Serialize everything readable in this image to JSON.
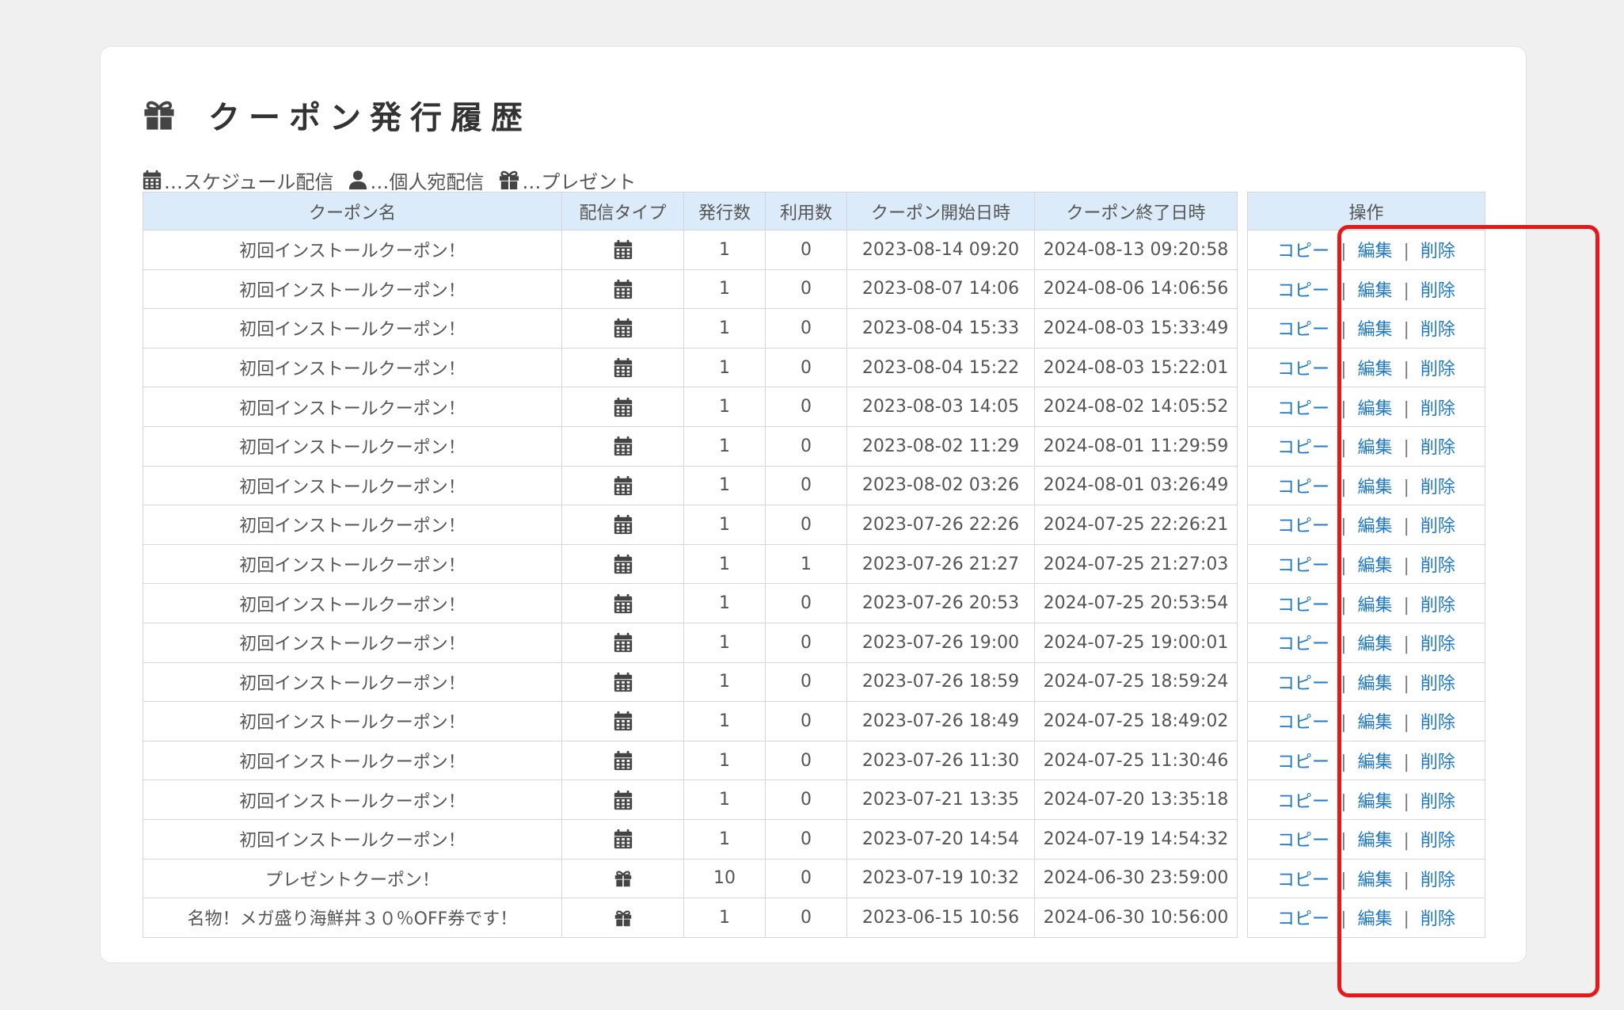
{
  "page": {
    "title": "クーポン発行履歴",
    "title_icon": "gift-icon"
  },
  "legend": [
    {
      "icon": "calendar-icon",
      "label": "…スケジュール配信"
    },
    {
      "icon": "user-icon",
      "label": "…個人宛配信"
    },
    {
      "icon": "gift-icon",
      "label": "…プレゼント"
    }
  ],
  "table": {
    "headers": {
      "name": "クーポン名",
      "type": "配信タイプ",
      "issued": "発行数",
      "used": "利用数",
      "start": "クーポン開始日時",
      "end": "クーポン終了日時",
      "ops": "操作"
    },
    "actions": {
      "copy": "コピー",
      "edit": "編集",
      "delete": "削除",
      "separator": "|"
    },
    "rows": [
      {
        "name": "初回インストールクーポン！",
        "type": "calendar-icon",
        "issued": "1",
        "used": "0",
        "start": "2023-08-14 09:20",
        "end": "2024-08-13 09:20:58"
      },
      {
        "name": "初回インストールクーポン！",
        "type": "calendar-icon",
        "issued": "1",
        "used": "0",
        "start": "2023-08-07 14:06",
        "end": "2024-08-06 14:06:56"
      },
      {
        "name": "初回インストールクーポン！",
        "type": "calendar-icon",
        "issued": "1",
        "used": "0",
        "start": "2023-08-04 15:33",
        "end": "2024-08-03 15:33:49"
      },
      {
        "name": "初回インストールクーポン！",
        "type": "calendar-icon",
        "issued": "1",
        "used": "0",
        "start": "2023-08-04 15:22",
        "end": "2024-08-03 15:22:01"
      },
      {
        "name": "初回インストールクーポン！",
        "type": "calendar-icon",
        "issued": "1",
        "used": "0",
        "start": "2023-08-03 14:05",
        "end": "2024-08-02 14:05:52"
      },
      {
        "name": "初回インストールクーポン！",
        "type": "calendar-icon",
        "issued": "1",
        "used": "0",
        "start": "2023-08-02 11:29",
        "end": "2024-08-01 11:29:59"
      },
      {
        "name": "初回インストールクーポン！",
        "type": "calendar-icon",
        "issued": "1",
        "used": "0",
        "start": "2023-08-02 03:26",
        "end": "2024-08-01 03:26:49"
      },
      {
        "name": "初回インストールクーポン！",
        "type": "calendar-icon",
        "issued": "1",
        "used": "0",
        "start": "2023-07-26 22:26",
        "end": "2024-07-25 22:26:21"
      },
      {
        "name": "初回インストールクーポン！",
        "type": "calendar-icon",
        "issued": "1",
        "used": "1",
        "start": "2023-07-26 21:27",
        "end": "2024-07-25 21:27:03"
      },
      {
        "name": "初回インストールクーポン！",
        "type": "calendar-icon",
        "issued": "1",
        "used": "0",
        "start": "2023-07-26 20:53",
        "end": "2024-07-25 20:53:54"
      },
      {
        "name": "初回インストールクーポン！",
        "type": "calendar-icon",
        "issued": "1",
        "used": "0",
        "start": "2023-07-26 19:00",
        "end": "2024-07-25 19:00:01"
      },
      {
        "name": "初回インストールクーポン！",
        "type": "calendar-icon",
        "issued": "1",
        "used": "0",
        "start": "2023-07-26 18:59",
        "end": "2024-07-25 18:59:24"
      },
      {
        "name": "初回インストールクーポン！",
        "type": "calendar-icon",
        "issued": "1",
        "used": "0",
        "start": "2023-07-26 18:49",
        "end": "2024-07-25 18:49:02"
      },
      {
        "name": "初回インストールクーポン！",
        "type": "calendar-icon",
        "issued": "1",
        "used": "0",
        "start": "2023-07-26 11:30",
        "end": "2024-07-25 11:30:46"
      },
      {
        "name": "初回インストールクーポン！",
        "type": "calendar-icon",
        "issued": "1",
        "used": "0",
        "start": "2023-07-21 13:35",
        "end": "2024-07-20 13:35:18"
      },
      {
        "name": "初回インストールクーポン！",
        "type": "calendar-icon",
        "issued": "1",
        "used": "0",
        "start": "2023-07-20 14:54",
        "end": "2024-07-19 14:54:32"
      },
      {
        "name": "プレゼントクーポン！",
        "type": "gift-icon",
        "issued": "10",
        "used": "0",
        "start": "2023-07-19 10:32",
        "end": "2024-06-30 23:59:00"
      },
      {
        "name": "名物！メガ盛り海鮮丼３０％OFF券です！",
        "type": "gift-icon",
        "issued": "1",
        "used": "0",
        "start": "2023-06-15 10:56",
        "end": "2024-06-30 10:56:00"
      }
    ]
  },
  "colors": {
    "header_bg": "#dcebf9",
    "link": "#1f78c8",
    "highlight": "#e81818",
    "icon": "#444444"
  }
}
